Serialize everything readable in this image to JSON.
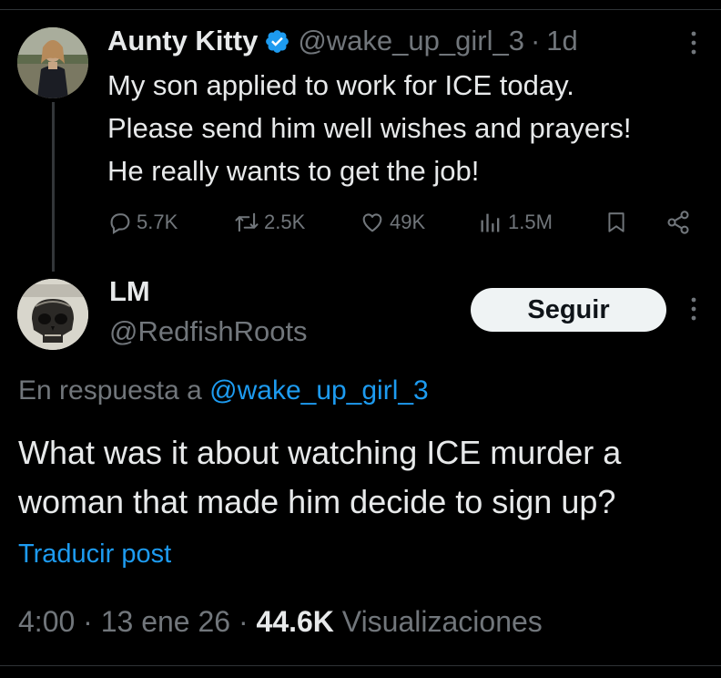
{
  "parent_tweet": {
    "author_name": "Aunty Kitty",
    "handle": "@wake_up_girl_3",
    "separator": "·",
    "time": "1d",
    "text": "My son applied to work for ICE today.\nPlease send him well wishes and prayers!\nHe really wants to get the job!",
    "verified": true,
    "actions": {
      "replies": "5.7K",
      "reposts": "2.5K",
      "likes": "49K",
      "views": "1.5M"
    }
  },
  "reply_tweet": {
    "author_name": "LM",
    "handle": "@RedfishRoots",
    "follow_label": "Seguir",
    "reply_prefix": "En respuesta a",
    "reply_mention": "@wake_up_girl_3",
    "text": "What was it about watching ICE murder a\nwoman that made him decide to sign up?",
    "translate_label": "Traducir post",
    "timestamp": "4:00 · 13 ene 26 ·",
    "views_count": "44.6K",
    "views_label": "Visualizaciones"
  },
  "icons": {
    "verified": "verified-badge-icon",
    "more": "more-vertical-icon",
    "reply": "reply-bubble-icon",
    "repost": "repost-icon",
    "like": "heart-icon",
    "views": "views-bar-chart-icon",
    "bookmark": "bookmark-icon",
    "share": "share-icon"
  },
  "colors": {
    "background": "#000000",
    "primary_text": "#e7e9ea",
    "secondary_text": "#71767b",
    "accent": "#1d9bf0",
    "follow_button_bg": "#eff3f4"
  }
}
